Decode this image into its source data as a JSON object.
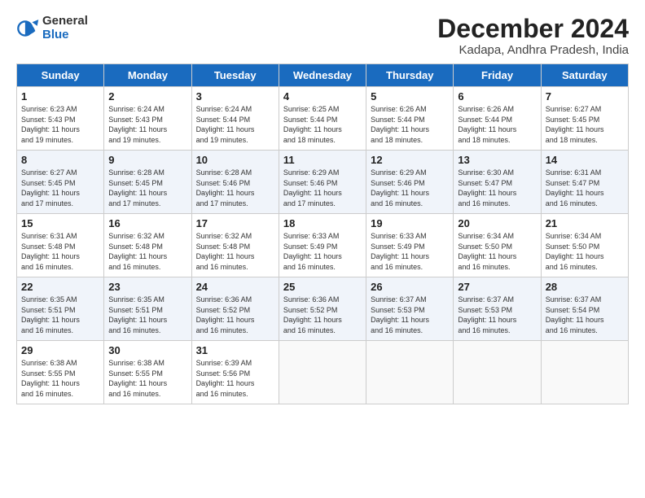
{
  "logo": {
    "general": "General",
    "blue": "Blue"
  },
  "title": "December 2024",
  "subtitle": "Kadapa, Andhra Pradesh, India",
  "days_of_week": [
    "Sunday",
    "Monday",
    "Tuesday",
    "Wednesday",
    "Thursday",
    "Friday",
    "Saturday"
  ],
  "weeks": [
    [
      {
        "day": "1",
        "info": "Sunrise: 6:23 AM\nSunset: 5:43 PM\nDaylight: 11 hours\nand 19 minutes."
      },
      {
        "day": "2",
        "info": "Sunrise: 6:24 AM\nSunset: 5:43 PM\nDaylight: 11 hours\nand 19 minutes."
      },
      {
        "day": "3",
        "info": "Sunrise: 6:24 AM\nSunset: 5:44 PM\nDaylight: 11 hours\nand 19 minutes."
      },
      {
        "day": "4",
        "info": "Sunrise: 6:25 AM\nSunset: 5:44 PM\nDaylight: 11 hours\nand 18 minutes."
      },
      {
        "day": "5",
        "info": "Sunrise: 6:26 AM\nSunset: 5:44 PM\nDaylight: 11 hours\nand 18 minutes."
      },
      {
        "day": "6",
        "info": "Sunrise: 6:26 AM\nSunset: 5:44 PM\nDaylight: 11 hours\nand 18 minutes."
      },
      {
        "day": "7",
        "info": "Sunrise: 6:27 AM\nSunset: 5:45 PM\nDaylight: 11 hours\nand 18 minutes."
      }
    ],
    [
      {
        "day": "8",
        "info": "Sunrise: 6:27 AM\nSunset: 5:45 PM\nDaylight: 11 hours\nand 17 minutes."
      },
      {
        "day": "9",
        "info": "Sunrise: 6:28 AM\nSunset: 5:45 PM\nDaylight: 11 hours\nand 17 minutes."
      },
      {
        "day": "10",
        "info": "Sunrise: 6:28 AM\nSunset: 5:46 PM\nDaylight: 11 hours\nand 17 minutes."
      },
      {
        "day": "11",
        "info": "Sunrise: 6:29 AM\nSunset: 5:46 PM\nDaylight: 11 hours\nand 17 minutes."
      },
      {
        "day": "12",
        "info": "Sunrise: 6:29 AM\nSunset: 5:46 PM\nDaylight: 11 hours\nand 16 minutes."
      },
      {
        "day": "13",
        "info": "Sunrise: 6:30 AM\nSunset: 5:47 PM\nDaylight: 11 hours\nand 16 minutes."
      },
      {
        "day": "14",
        "info": "Sunrise: 6:31 AM\nSunset: 5:47 PM\nDaylight: 11 hours\nand 16 minutes."
      }
    ],
    [
      {
        "day": "15",
        "info": "Sunrise: 6:31 AM\nSunset: 5:48 PM\nDaylight: 11 hours\nand 16 minutes."
      },
      {
        "day": "16",
        "info": "Sunrise: 6:32 AM\nSunset: 5:48 PM\nDaylight: 11 hours\nand 16 minutes."
      },
      {
        "day": "17",
        "info": "Sunrise: 6:32 AM\nSunset: 5:48 PM\nDaylight: 11 hours\nand 16 minutes."
      },
      {
        "day": "18",
        "info": "Sunrise: 6:33 AM\nSunset: 5:49 PM\nDaylight: 11 hours\nand 16 minutes."
      },
      {
        "day": "19",
        "info": "Sunrise: 6:33 AM\nSunset: 5:49 PM\nDaylight: 11 hours\nand 16 minutes."
      },
      {
        "day": "20",
        "info": "Sunrise: 6:34 AM\nSunset: 5:50 PM\nDaylight: 11 hours\nand 16 minutes."
      },
      {
        "day": "21",
        "info": "Sunrise: 6:34 AM\nSunset: 5:50 PM\nDaylight: 11 hours\nand 16 minutes."
      }
    ],
    [
      {
        "day": "22",
        "info": "Sunrise: 6:35 AM\nSunset: 5:51 PM\nDaylight: 11 hours\nand 16 minutes."
      },
      {
        "day": "23",
        "info": "Sunrise: 6:35 AM\nSunset: 5:51 PM\nDaylight: 11 hours\nand 16 minutes."
      },
      {
        "day": "24",
        "info": "Sunrise: 6:36 AM\nSunset: 5:52 PM\nDaylight: 11 hours\nand 16 minutes."
      },
      {
        "day": "25",
        "info": "Sunrise: 6:36 AM\nSunset: 5:52 PM\nDaylight: 11 hours\nand 16 minutes."
      },
      {
        "day": "26",
        "info": "Sunrise: 6:37 AM\nSunset: 5:53 PM\nDaylight: 11 hours\nand 16 minutes."
      },
      {
        "day": "27",
        "info": "Sunrise: 6:37 AM\nSunset: 5:53 PM\nDaylight: 11 hours\nand 16 minutes."
      },
      {
        "day": "28",
        "info": "Sunrise: 6:37 AM\nSunset: 5:54 PM\nDaylight: 11 hours\nand 16 minutes."
      }
    ],
    [
      {
        "day": "29",
        "info": "Sunrise: 6:38 AM\nSunset: 5:55 PM\nDaylight: 11 hours\nand 16 minutes."
      },
      {
        "day": "30",
        "info": "Sunrise: 6:38 AM\nSunset: 5:55 PM\nDaylight: 11 hours\nand 16 minutes."
      },
      {
        "day": "31",
        "info": "Sunrise: 6:39 AM\nSunset: 5:56 PM\nDaylight: 11 hours\nand 16 minutes."
      },
      {
        "day": "",
        "info": ""
      },
      {
        "day": "",
        "info": ""
      },
      {
        "day": "",
        "info": ""
      },
      {
        "day": "",
        "info": ""
      }
    ]
  ]
}
